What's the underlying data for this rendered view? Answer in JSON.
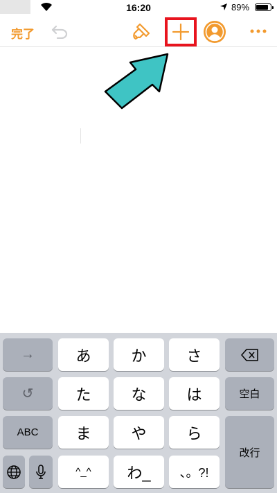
{
  "status_bar": {
    "time": "16:20",
    "battery_percent": "89%",
    "battery_level": 0.89
  },
  "toolbar": {
    "done_label": "完了"
  },
  "keyboard": {
    "forward_label": "→",
    "undo_label": "↺",
    "abc_label": "ABC",
    "space_label": "空白",
    "return_label": "改行",
    "keys": [
      "あ",
      "か",
      "さ",
      "た",
      "な",
      "は",
      "ま",
      "や",
      "ら",
      "^_^",
      "わ_",
      "、。?!"
    ]
  },
  "colors": {
    "accent": "#f29a2e",
    "highlight": "#e8141e",
    "pointer_arrow": "#3fc4c4"
  }
}
